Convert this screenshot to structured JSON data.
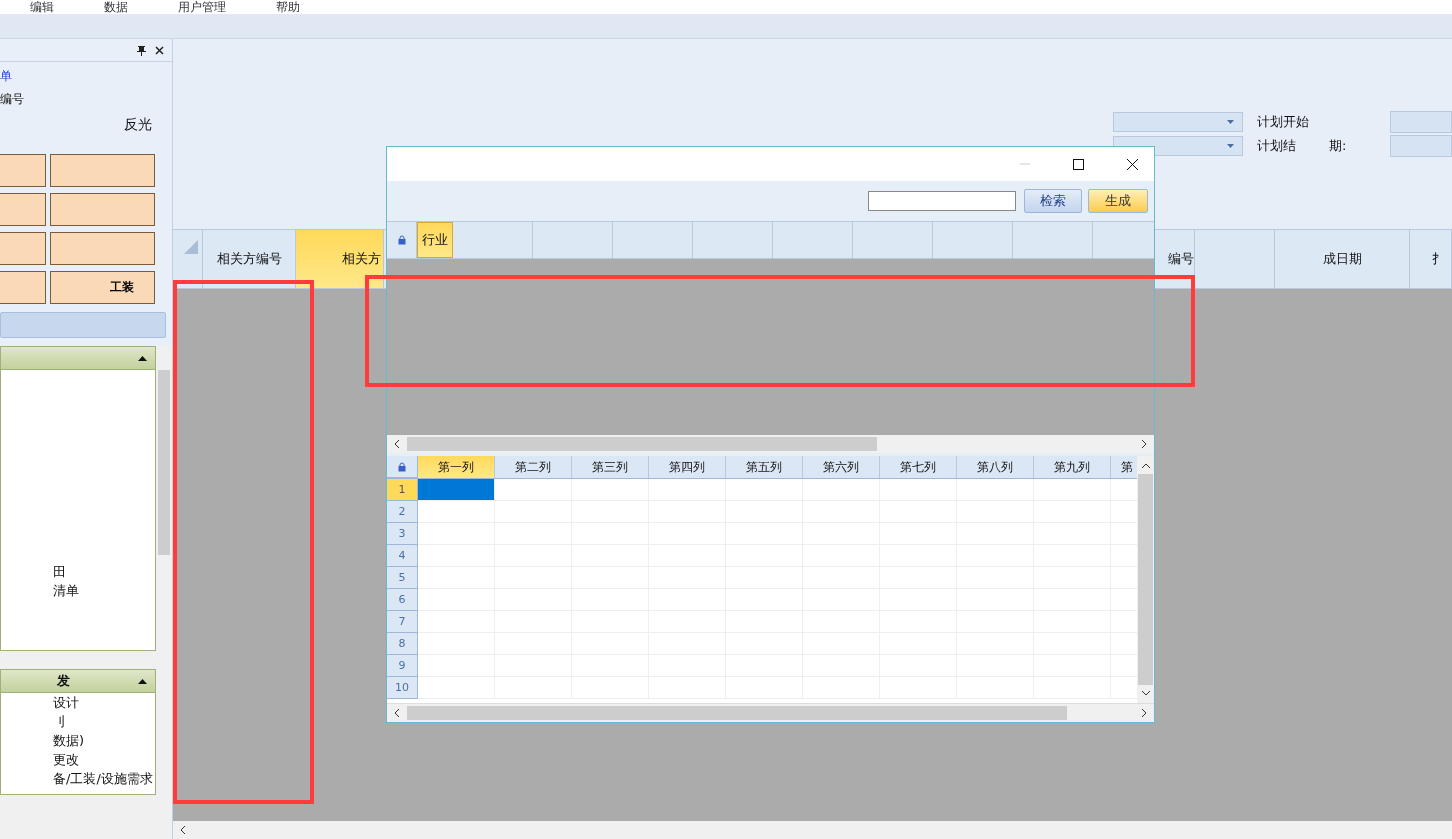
{
  "menu": [
    {
      "label": "编辑"
    },
    {
      "label": "数据"
    },
    {
      "label": "用户管理"
    },
    {
      "label": "帮助"
    }
  ],
  "side_panel": {
    "link": "单",
    "field_label": "编号",
    "note": "反光",
    "buttons": [
      {
        "label": "工装",
        "kind": "tool"
      }
    ],
    "sections": [
      {
        "expanded": true,
        "items": [
          "田",
          "清单"
        ]
      },
      {
        "title": "发",
        "expanded": true,
        "items": [
          "设计",
          "刂",
          "数据)",
          "更改",
          "备/工装/设施需求"
        ]
      }
    ]
  },
  "form": {
    "fields": [
      {
        "label": "计划开始"
      },
      {
        "label": "计划结",
        "label_end": "期:"
      }
    ]
  },
  "grid": {
    "columns": [
      {
        "label": "相关方编号",
        "selected": false
      },
      {
        "label": "相关方",
        "selected": true
      },
      {
        "label": "编号",
        "selected": false
      },
      {
        "label": "成日期",
        "selected": false
      },
      {
        "label": "扌",
        "selected": false
      }
    ]
  },
  "dialog": {
    "buttons": [
      {
        "label": "检索",
        "kind": "normal"
      },
      {
        "label": "生成",
        "kind": "primary"
      }
    ],
    "upper_grid": {
      "columns": [
        {
          "label": "行业",
          "selected": true
        }
      ]
    },
    "lower_grid": {
      "columns": [
        {
          "label": "第一列",
          "selected": true
        },
        {
          "label": "第二列",
          "selected": false
        },
        {
          "label": "第三列",
          "selected": false
        },
        {
          "label": "第四列",
          "selected": false
        },
        {
          "label": "第五列",
          "selected": false
        },
        {
          "label": "第六列",
          "selected": false
        },
        {
          "label": "第七列",
          "selected": false
        },
        {
          "label": "第八列",
          "selected": false
        },
        {
          "label": "第九列",
          "selected": false
        },
        {
          "label": "第",
          "selected": false
        }
      ],
      "rows": [
        {
          "label": "1",
          "selected": true
        },
        {
          "label": "2",
          "selected": false
        },
        {
          "label": "3",
          "selected": false
        },
        {
          "label": "4",
          "selected": false
        },
        {
          "label": "5",
          "selected": false
        },
        {
          "label": "6",
          "selected": false
        },
        {
          "label": "7",
          "selected": false
        },
        {
          "label": "8",
          "selected": false
        },
        {
          "label": "9",
          "selected": false
        },
        {
          "label": "10",
          "selected": false
        }
      ]
    }
  },
  "annotation_frames": {
    "grid_column": true,
    "dialog_row": true
  }
}
